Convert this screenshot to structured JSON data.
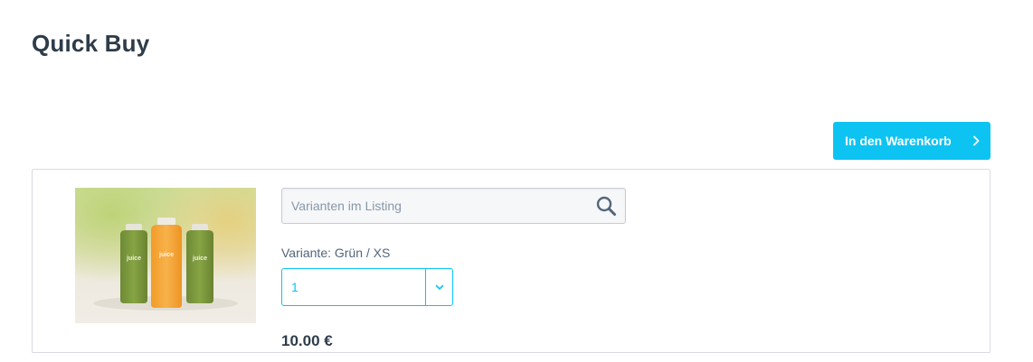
{
  "page": {
    "title": "Quick Buy"
  },
  "cart_button": {
    "label": "In den Warenkorb",
    "icon": "chevron-right-icon"
  },
  "product": {
    "image_alt": "juice bottles",
    "bottle_label": "juice",
    "search": {
      "placeholder": "Varianten im Listing",
      "value": "",
      "icon": "search-icon"
    },
    "variant_label": "Variante: Grün / XS",
    "quantity": {
      "selected": "1",
      "icon": "chevron-down-icon"
    },
    "price": "10.00 €"
  },
  "colors": {
    "accent": "#0dc3f2",
    "title": "#2e3c4a",
    "text": "#52667a",
    "border": "#dadae5"
  }
}
